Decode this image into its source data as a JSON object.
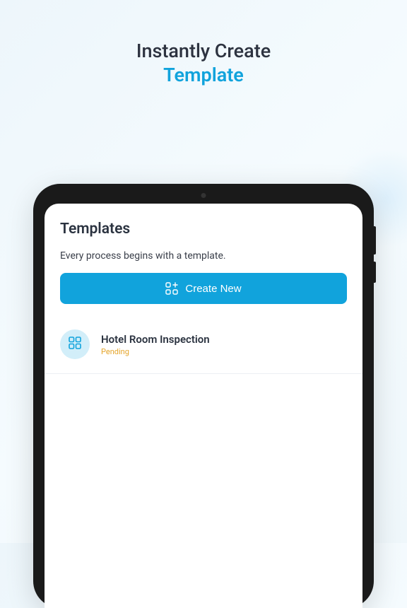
{
  "hero": {
    "line1": "Instantly Create",
    "line2": "Template"
  },
  "screen": {
    "title": "Templates",
    "subtitle": "Every process begins with a template.",
    "createButton": {
      "label": "Create New"
    },
    "templates": [
      {
        "name": "Hotel Room Inspection",
        "status": "Pending"
      }
    ]
  },
  "colors": {
    "accent": "#11a3dc",
    "pending": "#e5a52b"
  }
}
